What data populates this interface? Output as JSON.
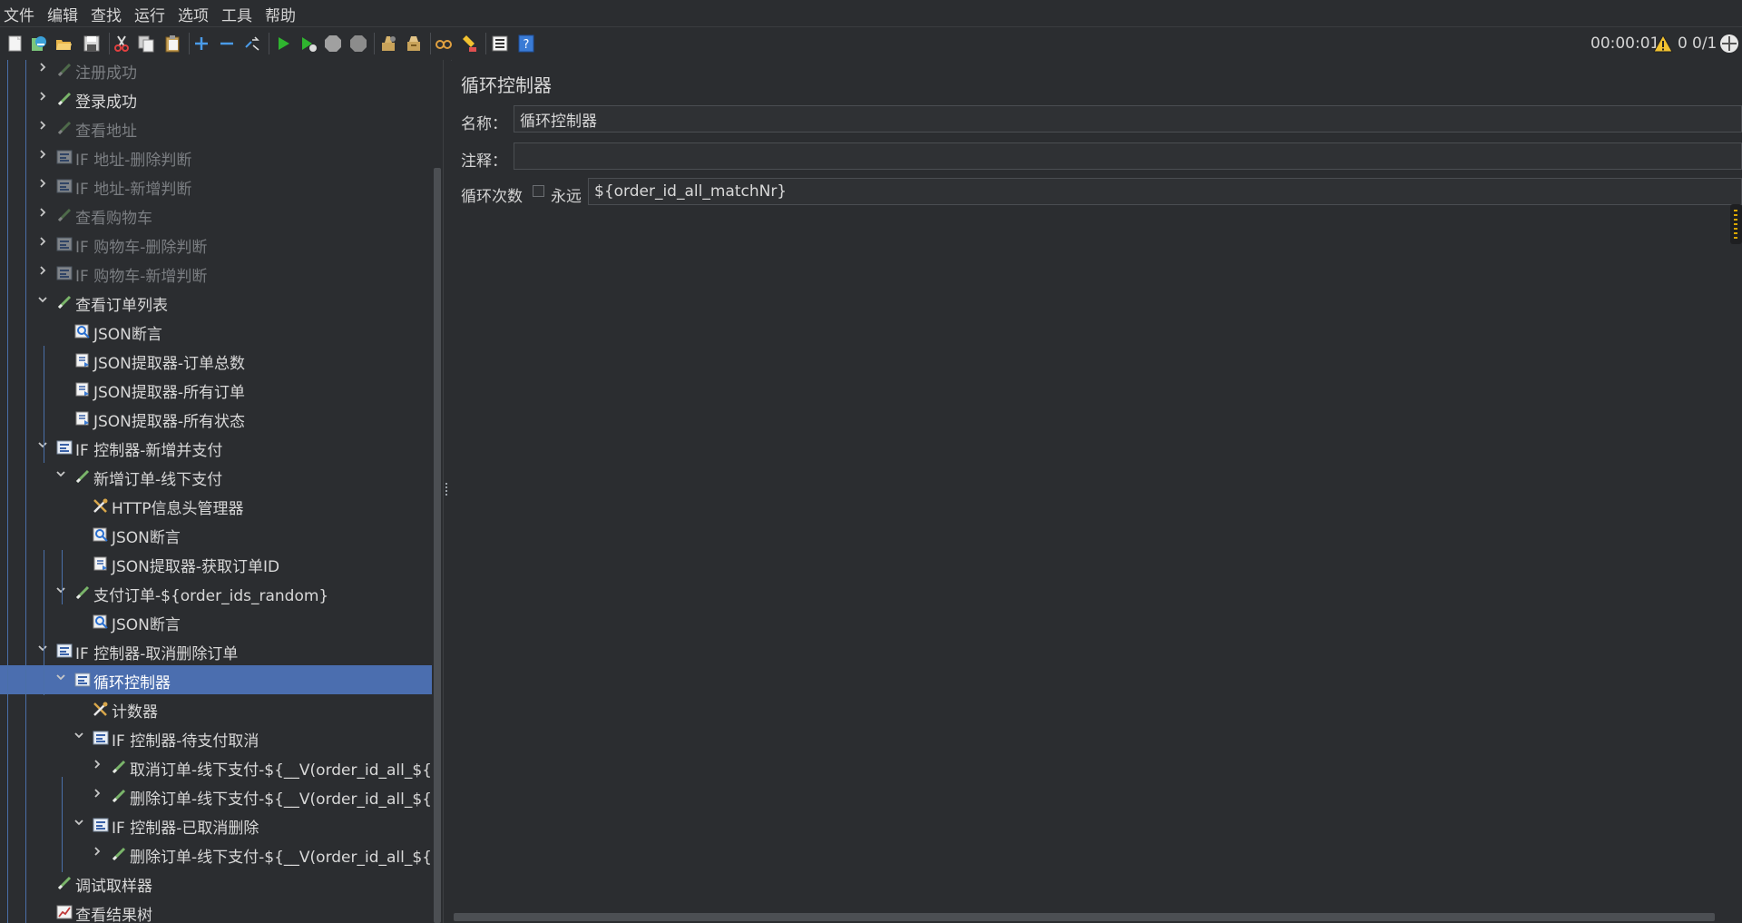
{
  "menu": [
    "文件",
    "编辑",
    "查找",
    "运行",
    "选项",
    "工具",
    "帮助"
  ],
  "toolbar": {
    "icons": [
      "new-icon",
      "templates-icon",
      "open-icon",
      "save-icon",
      "cut-icon",
      "copy-icon",
      "paste-icon",
      "expand-icon",
      "collapse-icon",
      "toggle-icon",
      "start-icon",
      "start-no-pauses-icon",
      "stop-icon",
      "shutdown-icon",
      "clear-icon",
      "clear-all-icon",
      "search-icon",
      "reset-search-icon",
      "function-helper-icon",
      "help-icon"
    ]
  },
  "status": {
    "time": "00:00:01",
    "warnings": "0",
    "threads": "0/1"
  },
  "tree": {
    "items": [
      {
        "label": "注册成功",
        "icon": "sampler-icon",
        "enabled": false,
        "expanded": false
      },
      {
        "label": "登录成功",
        "icon": "sampler-icon",
        "enabled": true,
        "expanded": false
      },
      {
        "label": "查看地址",
        "icon": "sampler-icon",
        "enabled": false,
        "expanded": false
      },
      {
        "label": "IF 地址-删除判断",
        "icon": "controller-icon",
        "enabled": false,
        "expanded": false
      },
      {
        "label": "IF 地址-新增判断",
        "icon": "controller-icon",
        "enabled": false,
        "expanded": false
      },
      {
        "label": "查看购物车",
        "icon": "sampler-icon",
        "enabled": false,
        "expanded": false
      },
      {
        "label": "IF 购物车-删除判断",
        "icon": "controller-icon",
        "enabled": false,
        "expanded": false
      },
      {
        "label": "IF 购物车-新增判断",
        "icon": "controller-icon",
        "enabled": false,
        "expanded": false
      },
      {
        "label": "查看订单列表",
        "icon": "sampler-icon",
        "enabled": true,
        "expanded": true
      },
      {
        "label": "JSON断言",
        "icon": "assertion-icon",
        "enabled": true
      },
      {
        "label": "JSON提取器-订单总数",
        "icon": "extractor-icon",
        "enabled": true
      },
      {
        "label": "JSON提取器-所有订单",
        "icon": "extractor-icon",
        "enabled": true
      },
      {
        "label": "JSON提取器-所有状态",
        "icon": "extractor-icon",
        "enabled": true
      },
      {
        "label": "IF 控制器-新增并支付",
        "icon": "controller-icon",
        "enabled": true,
        "expanded": true
      },
      {
        "label": "新增订单-线下支付",
        "icon": "sampler-icon",
        "enabled": true,
        "expanded": true
      },
      {
        "label": "HTTP信息头管理器",
        "icon": "config-icon",
        "enabled": true
      },
      {
        "label": "JSON断言",
        "icon": "assertion-icon",
        "enabled": true
      },
      {
        "label": "JSON提取器-获取订单ID",
        "icon": "extractor-icon",
        "enabled": true
      },
      {
        "label": "支付订单-${order_ids_random}",
        "icon": "sampler-icon",
        "enabled": true,
        "expanded": true
      },
      {
        "label": "JSON断言",
        "icon": "assertion-icon",
        "enabled": true
      },
      {
        "label": "IF 控制器-取消删除订单",
        "icon": "controller-icon",
        "enabled": true,
        "expanded": true
      },
      {
        "label": "循环控制器",
        "icon": "controller-icon",
        "enabled": true,
        "expanded": true,
        "selected": true
      },
      {
        "label": "计数器",
        "icon": "config-icon",
        "enabled": true
      },
      {
        "label": "IF 控制器-待支付取消",
        "icon": "controller-icon",
        "enabled": true,
        "expanded": true
      },
      {
        "label": "取消订单-线下支付-${__V(order_id_all_${n})}",
        "icon": "sampler-icon",
        "enabled": true,
        "expanded": false
      },
      {
        "label": "删除订单-线下支付-${__V(order_id_all_${n})}",
        "icon": "sampler-icon",
        "enabled": true,
        "expanded": false
      },
      {
        "label": "IF 控制器-已取消删除",
        "icon": "controller-icon",
        "enabled": true,
        "expanded": true
      },
      {
        "label": "删除订单-线下支付-${__V(order_id_all_${n})}",
        "icon": "sampler-icon",
        "enabled": true,
        "expanded": false
      },
      {
        "label": "调试取样器",
        "icon": "sampler-icon",
        "enabled": true
      },
      {
        "label": "查看结果树",
        "icon": "listener-icon",
        "enabled": true
      }
    ]
  },
  "editor": {
    "title": "循环控制器",
    "name_label": "名称：",
    "name_value": "循环控制器",
    "comment_label": "注释：",
    "comment_value": "",
    "loop_label": "循环次数",
    "forever_label": "永远",
    "forever_checked": false,
    "loop_value": "${order_id_all_matchNr}"
  }
}
